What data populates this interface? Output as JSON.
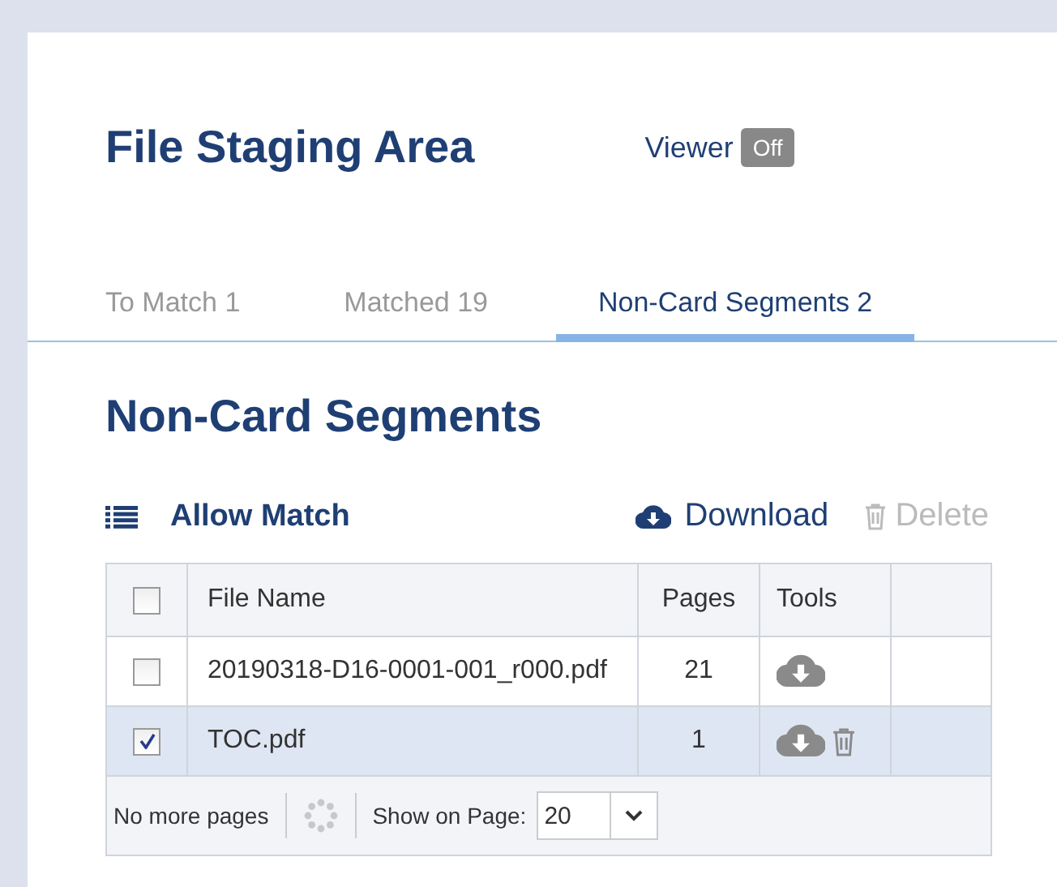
{
  "header": {
    "title": "File Staging Area",
    "viewer_label": "Viewer",
    "viewer_toggle": "Off"
  },
  "tabs": [
    {
      "label": "To Match 1",
      "selected": false
    },
    {
      "label": "Matched 19",
      "selected": false
    },
    {
      "label": "Non-Card Segments 2",
      "selected": true
    }
  ],
  "section_title": "Non-Card Segments",
  "toolbar": {
    "allow_match": "Allow Match",
    "download": "Download",
    "delete": "Delete",
    "delete_disabled": true
  },
  "table": {
    "select_all_checked": false,
    "columns": [
      "File Name",
      "Pages",
      "Tools"
    ],
    "rows": [
      {
        "file_name": "20190318-D16-0001-001_r000.pdf",
        "pages": "21",
        "selected": false,
        "can_delete": false
      },
      {
        "file_name": "TOC.pdf",
        "pages": "1",
        "selected": true,
        "can_delete": true
      }
    ]
  },
  "footer": {
    "status": "No more pages",
    "show_label": "Show on Page:",
    "page_size": "20"
  }
}
